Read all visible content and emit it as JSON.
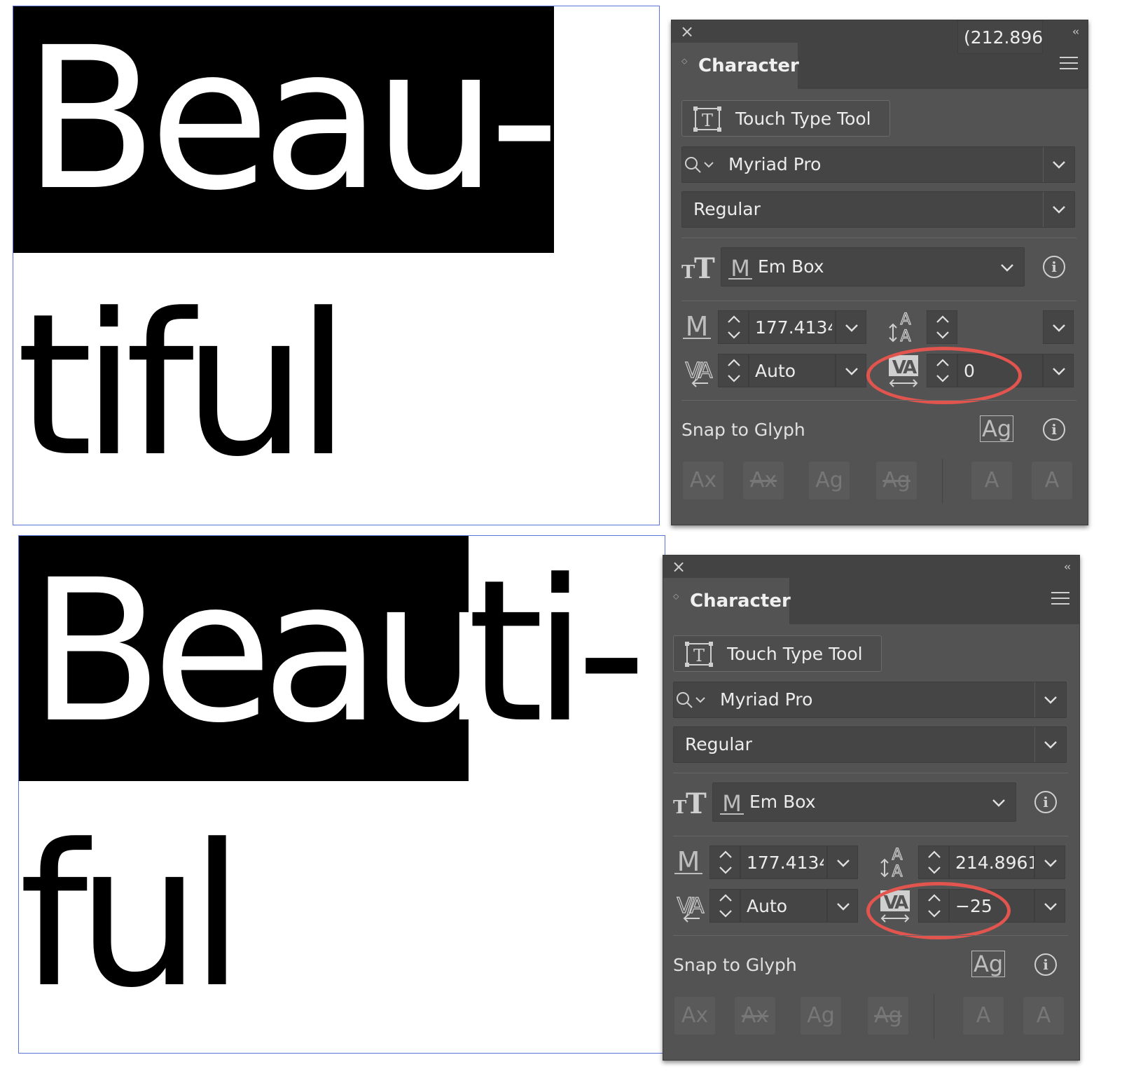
{
  "top": {
    "artboard": {
      "line1": "Beau-",
      "line2": "tiful"
    },
    "panel": {
      "title": "Character",
      "touch_type_label": "Touch Type Tool",
      "font_family": "Myriad Pro",
      "font_style": "Regular",
      "alignment_label": "Em Box",
      "font_size": "177.4134",
      "leading": "(212.896",
      "kerning": "Auto",
      "tracking": "0",
      "snap_label": "Snap to Glyph"
    }
  },
  "bottom": {
    "artboard": {
      "line1a": "Beau",
      "line1b": "ti-",
      "line2": "ful"
    },
    "panel": {
      "title": "Character",
      "touch_type_label": "Touch Type Tool",
      "font_family": "Myriad Pro",
      "font_style": "Regular",
      "alignment_label": "Em Box",
      "font_size": "177.4134",
      "leading": "214.8961",
      "kerning": "Auto",
      "tracking": "−25",
      "snap_label": "Snap to Glyph"
    }
  },
  "glyph_icons": {
    "snap_icon": "Ag",
    "buttons": [
      "Ax",
      "Ax",
      "Ag",
      "Ag",
      "A",
      "A"
    ]
  },
  "colors": {
    "panel_bg": "#535353",
    "field_bg": "#454545",
    "highlight_ring": "#e2544e",
    "artboard_border": "#5a73d6"
  }
}
